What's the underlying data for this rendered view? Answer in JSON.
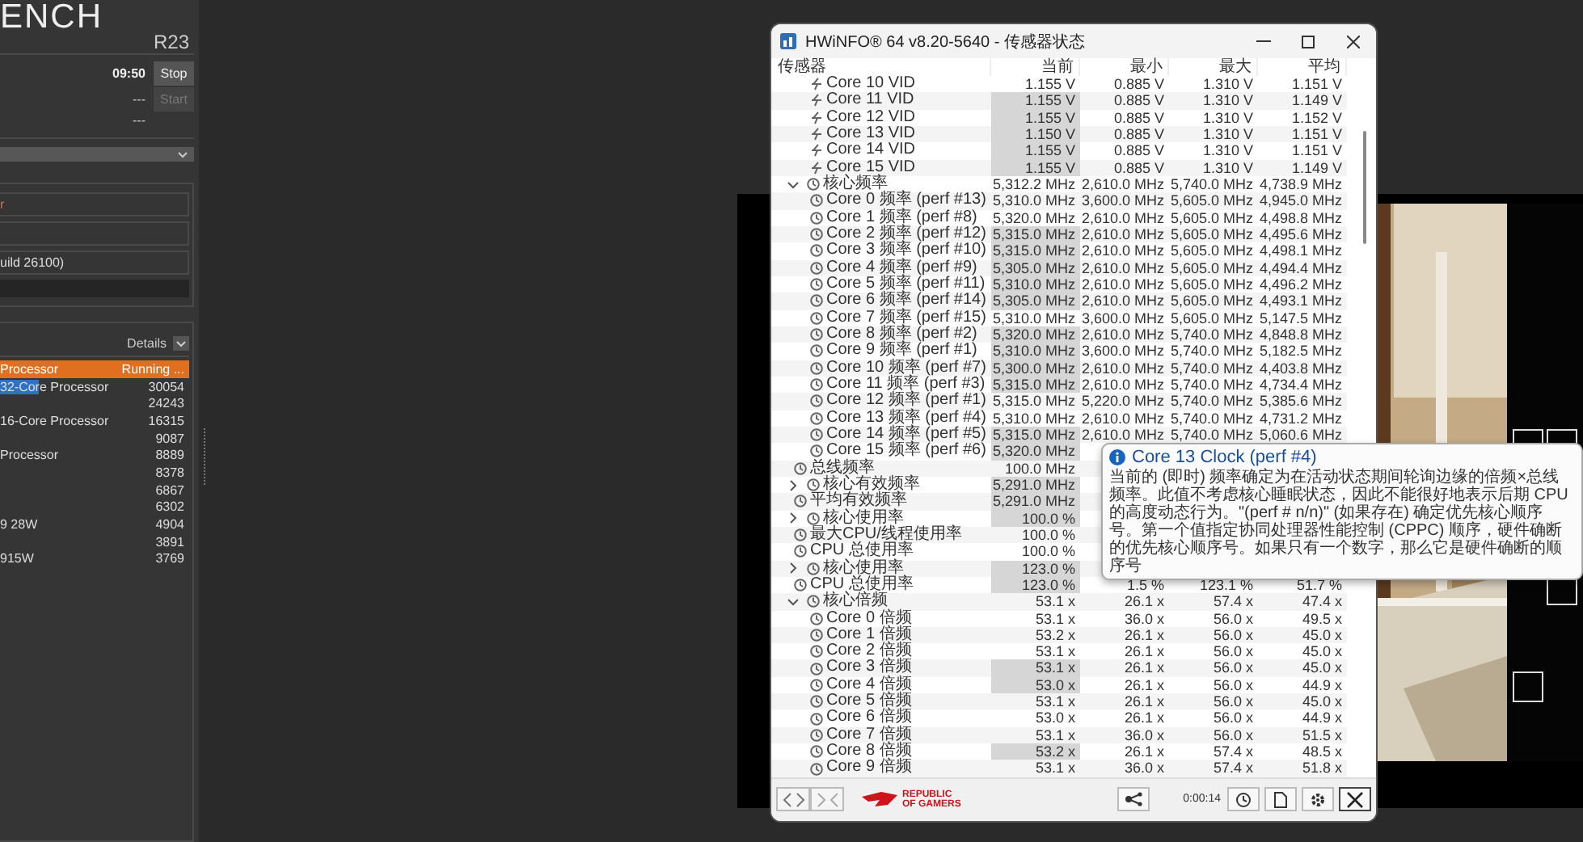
{
  "cinebench": {
    "title": "ENCH",
    "version": "R23",
    "controls": [
      {
        "time": "09:50",
        "button": "Stop",
        "disabled": false
      },
      {
        "time": "---",
        "button": "Start",
        "disabled": true
      },
      {
        "time": "---"
      }
    ],
    "fields": [
      {
        "kind": "processor",
        "value": "r"
      },
      {
        "kind": "blank"
      },
      {
        "kind": "os",
        "value": "uild 26100)"
      },
      {
        "kind": "bar"
      }
    ],
    "details_label": "Details",
    "ranking": [
      {
        "name": "Processor",
        "score": "Running ...",
        "running": true,
        "highlighted": false
      },
      {
        "name": "32-Core Processor",
        "score": "30054",
        "running": false,
        "highlighted": true
      },
      {
        "score": "24243",
        "running": false
      },
      {
        "name": "16-Core Processor",
        "score": "16315",
        "running": false,
        "highlighted": false
      },
      {
        "score": "9087",
        "running": false
      },
      {
        "name": "Processor",
        "score": "8889",
        "running": false,
        "highlighted": false
      },
      {
        "score": "8378",
        "running": false
      },
      {
        "score": "6867",
        "running": false
      },
      {
        "score": "6302",
        "running": false
      },
      {
        "name": "9 28W",
        "score": "4904",
        "running": false,
        "highlighted": false
      },
      {
        "score": "3891",
        "running": false
      },
      {
        "name": "915W",
        "score": "3769",
        "running": false,
        "highlighted": false
      }
    ]
  },
  "hwinfo": {
    "title": "HWiNFO® 64 v8.20-5640 - 传感器状态",
    "columns": [
      "传感器",
      "当前",
      "最小",
      "最大",
      "平均"
    ],
    "sensors": [
      {
        "children": [
          {
            "label": "Core 10 VID",
            "kind": "voltage",
            "changed": false,
            "current": "1.155 V",
            "min": "0.885 V",
            "max": "1.310 V",
            "avg": "1.151 V"
          },
          {
            "label": "Core 11 VID",
            "kind": "voltage",
            "changed": true,
            "current": "1.155 V",
            "min": "0.885 V",
            "max": "1.310 V",
            "avg": "1.149 V"
          },
          {
            "label": "Core 12 VID",
            "kind": "voltage",
            "changed": true,
            "current": "1.155 V",
            "min": "0.885 V",
            "max": "1.310 V",
            "avg": "1.152 V"
          },
          {
            "label": "Core 13 VID",
            "kind": "voltage",
            "changed": true,
            "current": "1.150 V",
            "min": "0.885 V",
            "max": "1.310 V",
            "avg": "1.151 V"
          },
          {
            "label": "Core 14 VID",
            "kind": "voltage",
            "changed": true,
            "current": "1.155 V",
            "min": "0.885 V",
            "max": "1.310 V",
            "avg": "1.151 V"
          },
          {
            "label": "Core 15 VID",
            "kind": "voltage",
            "changed": true,
            "current": "1.155 V",
            "min": "0.885 V",
            "max": "1.310 V",
            "avg": "1.149 V"
          }
        ]
      },
      {
        "label": "核心频率",
        "kind": "clock",
        "expanded": true,
        "changed": false,
        "current": "5,312.2 MHz",
        "min": "2,610.0 MHz",
        "max": "5,740.0 MHz",
        "avg": "4,738.9 MHz",
        "children": [
          {
            "label": "Core 0 频率 (perf #13)",
            "kind": "clock",
            "changed": false,
            "current": "5,310.0 MHz",
            "min": "3,600.0 MHz",
            "max": "5,605.0 MHz",
            "avg": "4,945.0 MHz"
          },
          {
            "label": "Core 1 频率 (perf #8)",
            "kind": "clock",
            "changed": false,
            "current": "5,320.0 MHz",
            "min": "2,610.0 MHz",
            "max": "5,605.0 MHz",
            "avg": "4,498.8 MHz"
          },
          {
            "label": "Core 2 频率 (perf #12)",
            "kind": "clock",
            "changed": true,
            "current": "5,315.0 MHz",
            "min": "2,610.0 MHz",
            "max": "5,605.0 MHz",
            "avg": "4,495.6 MHz"
          },
          {
            "label": "Core 3 频率 (perf #10)",
            "kind": "clock",
            "changed": true,
            "current": "5,315.0 MHz",
            "min": "2,610.0 MHz",
            "max": "5,605.0 MHz",
            "avg": "4,498.1 MHz"
          },
          {
            "label": "Core 4 频率 (perf #9)",
            "kind": "clock",
            "changed": true,
            "current": "5,305.0 MHz",
            "min": "2,610.0 MHz",
            "max": "5,605.0 MHz",
            "avg": "4,494.4 MHz"
          },
          {
            "label": "Core 5 频率 (perf #11)",
            "kind": "clock",
            "changed": true,
            "current": "5,310.0 MHz",
            "min": "2,610.0 MHz",
            "max": "5,605.0 MHz",
            "avg": "4,496.2 MHz"
          },
          {
            "label": "Core 6 频率 (perf #14)",
            "kind": "clock",
            "changed": true,
            "current": "5,305.0 MHz",
            "min": "2,610.0 MHz",
            "max": "5,605.0 MHz",
            "avg": "4,493.1 MHz"
          },
          {
            "label": "Core 7 频率 (perf #15)",
            "kind": "clock",
            "changed": false,
            "current": "5,310.0 MHz",
            "min": "3,600.0 MHz",
            "max": "5,605.0 MHz",
            "avg": "5,147.5 MHz"
          },
          {
            "label": "Core 8 频率 (perf #2)",
            "kind": "clock",
            "changed": true,
            "current": "5,320.0 MHz",
            "min": "2,610.0 MHz",
            "max": "5,740.0 MHz",
            "avg": "4,848.8 MHz"
          },
          {
            "label": "Core 9 频率 (perf #1)",
            "kind": "clock",
            "changed": true,
            "current": "5,310.0 MHz",
            "min": "3,600.0 MHz",
            "max": "5,740.0 MHz",
            "avg": "5,182.5 MHz"
          },
          {
            "label": "Core 10 频率 (perf #7)",
            "kind": "clock",
            "changed": true,
            "current": "5,300.0 MHz",
            "min": "2,610.0 MHz",
            "max": "5,740.0 MHz",
            "avg": "4,403.8 MHz"
          },
          {
            "label": "Core 11 频率 (perf #3)",
            "kind": "clock",
            "changed": true,
            "current": "5,315.0 MHz",
            "min": "2,610.0 MHz",
            "max": "5,740.0 MHz",
            "avg": "4,734.4 MHz"
          },
          {
            "label": "Core 12 频率 (perf #1)",
            "kind": "clock",
            "changed": false,
            "current": "5,315.0 MHz",
            "min": "5,220.0 MHz",
            "max": "5,740.0 MHz",
            "avg": "5,385.6 MHz"
          },
          {
            "label": "Core 13 频率 (perf #4)",
            "kind": "clock",
            "changed": false,
            "current": "5,310.0 MHz",
            "min": "2,610.0 MHz",
            "max": "5,740.0 MHz",
            "avg": "4,731.2 MHz"
          },
          {
            "label": "Core 14 频率 (perf #5)",
            "kind": "clock",
            "changed": true,
            "current": "5,315.0 MHz",
            "min": "2,610.0 MHz",
            "max": "5,740.0 MHz",
            "avg": "5,060.6 MHz"
          },
          {
            "label": "Core 15 频率 (perf #6)",
            "kind": "clock",
            "changed": true,
            "current": "5,320.0 MHz"
          }
        ]
      },
      {
        "label": "总线频率",
        "kind": "clock",
        "changed": false,
        "current": "100.0 MHz"
      },
      {
        "label": "核心有效频率",
        "kind": "clock",
        "expanded": false,
        "changed": true,
        "current": "5,291.0 MHz"
      },
      {
        "label": "平均有效频率",
        "kind": "clock",
        "changed": true,
        "current": "5,291.0 MHz"
      },
      {
        "label": "核心使用率",
        "kind": "clock",
        "expanded": false,
        "changed": true,
        "current": "100.0 %"
      },
      {
        "label": "最大CPU/线程使用率",
        "kind": "clock",
        "changed": false,
        "current": "100.0 %"
      },
      {
        "label": "CPU 总使用率",
        "kind": "clock",
        "changed": false,
        "current": "100.0 %"
      },
      {
        "label": "核心使用率",
        "kind": "clock",
        "expanded": false,
        "changed": true,
        "current": "123.0 %"
      },
      {
        "label": "CPU 总使用率",
        "kind": "clock",
        "changed": true,
        "current": "123.0 %",
        "min": "1.5 %",
        "max": "123.1 %",
        "avg": "51.7 %"
      },
      {
        "label": "核心倍频",
        "kind": "clock",
        "expanded": true,
        "changed": false,
        "current": "53.1 x",
        "min": "26.1 x",
        "max": "57.4 x",
        "avg": "47.4 x",
        "children": [
          {
            "label": "Core 0 倍频",
            "kind": "clock",
            "changed": false,
            "current": "53.1 x",
            "min": "36.0 x",
            "max": "56.0 x",
            "avg": "49.5 x"
          },
          {
            "label": "Core 1 倍频",
            "kind": "clock",
            "changed": false,
            "current": "53.2 x",
            "min": "26.1 x",
            "max": "56.0 x",
            "avg": "45.0 x"
          },
          {
            "label": "Core 2 倍频",
            "kind": "clock",
            "changed": false,
            "current": "53.1 x",
            "min": "26.1 x",
            "max": "56.0 x",
            "avg": "45.0 x"
          },
          {
            "label": "Core 3 倍频",
            "kind": "clock",
            "changed": true,
            "current": "53.1 x",
            "min": "26.1 x",
            "max": "56.0 x",
            "avg": "45.0 x"
          },
          {
            "label": "Core 4 倍频",
            "kind": "clock",
            "changed": true,
            "current": "53.0 x",
            "min": "26.1 x",
            "max": "56.0 x",
            "avg": "44.9 x"
          },
          {
            "label": "Core 5 倍频",
            "kind": "clock",
            "changed": false,
            "current": "53.1 x",
            "min": "26.1 x",
            "max": "56.0 x",
            "avg": "45.0 x"
          },
          {
            "label": "Core 6 倍频",
            "kind": "clock",
            "changed": false,
            "current": "53.0 x",
            "min": "26.1 x",
            "max": "56.0 x",
            "avg": "44.9 x"
          },
          {
            "label": "Core 7 倍频",
            "kind": "clock",
            "changed": false,
            "current": "53.1 x",
            "min": "36.0 x",
            "max": "56.0 x",
            "avg": "51.5 x"
          },
          {
            "label": "Core 8 倍频",
            "kind": "clock",
            "changed": true,
            "current": "53.2 x",
            "min": "26.1 x",
            "max": "57.4 x",
            "avg": "48.5 x"
          },
          {
            "label": "Core 9 倍频",
            "kind": "clock",
            "changed": false,
            "current": "53.1 x",
            "min": "36.0 x",
            "max": "57.4 x",
            "avg": "51.8 x"
          }
        ]
      }
    ],
    "logo_text": "REPUBLIC OF GAMERS",
    "timer": "0:00:14",
    "tooltip": {
      "title": "Core 13 Clock (perf #4)",
      "text": "当前的 (即时) 频率确定为在活动状态期间轮询边缘的倍频×总线频率。此值不考虑核心睡眠状态，因此不能很好地表示后期 CPU 的高度动态行为。\"(perf # n/n)\" (如果存在) 确定优先核心顺序号。第一个值指定协同处理器性能控制 (CPPC) 顺序，硬件确断的优先核心顺序号。如果只有一个数字，那么它是硬件确断的顺序号"
    }
  }
}
